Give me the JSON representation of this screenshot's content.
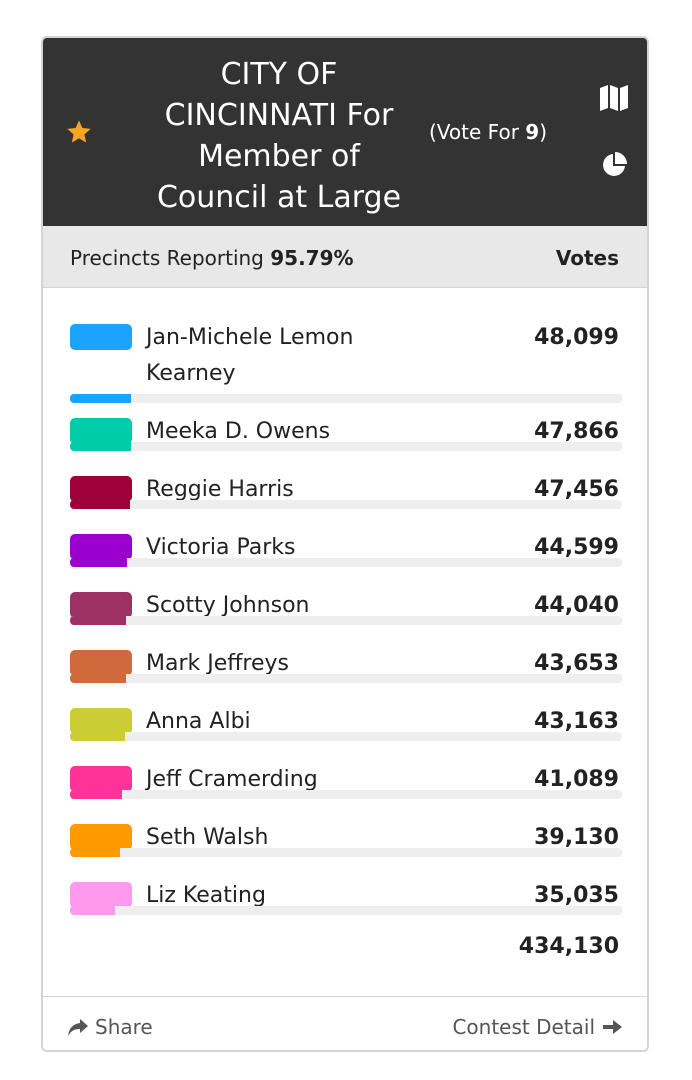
{
  "header": {
    "title": "CITY OF CINCINNATI For Member of Council at Large",
    "vote_for_prefix": "(Vote For ",
    "vote_for_count": "9",
    "vote_for_suffix": ")",
    "icons": [
      "star-icon",
      "map-icon",
      "pie-chart-icon"
    ],
    "colors": {
      "header_bg": "#333333",
      "star": "#f5a623"
    }
  },
  "subheader": {
    "precincts_label": "Precincts Reporting",
    "precincts_value": "95.79%",
    "votes_label": "Votes"
  },
  "candidates": [
    {
      "name": "Jan-Michele Lemon Kearney",
      "votes": "48,099",
      "color": "#1aa3ff",
      "share": 0.1108
    },
    {
      "name": "Meeka D. Owens",
      "votes": "47,866",
      "color": "#00ccaa",
      "share": 0.1103
    },
    {
      "name": "Reggie Harris",
      "votes": "47,456",
      "color": "#9e0038",
      "share": 0.1093
    },
    {
      "name": "Victoria Parks",
      "votes": "44,599",
      "color": "#9b00d1",
      "share": 0.1027
    },
    {
      "name": "Scotty Johnson",
      "votes": "44,040",
      "color": "#9e3163",
      "share": 0.1014
    },
    {
      "name": "Mark Jeffreys",
      "votes": "43,653",
      "color": "#d06a3a",
      "share": 0.1006
    },
    {
      "name": "Anna Albi",
      "votes": "43,163",
      "color": "#cccc33",
      "share": 0.0994
    },
    {
      "name": "Jeff Cramerding",
      "votes": "41,089",
      "color": "#ff3399",
      "share": 0.0946
    },
    {
      "name": "Seth Walsh",
      "votes": "39,130",
      "color": "#ff9900",
      "share": 0.0901
    },
    {
      "name": "Liz Keating",
      "votes": "35,035",
      "color": "#ff99ee",
      "share": 0.0807
    }
  ],
  "total_votes": "434,130",
  "footer": {
    "share_label": "Share",
    "detail_label": "Contest Detail",
    "icons": [
      "share-arrow-icon",
      "arrow-right-icon"
    ]
  }
}
